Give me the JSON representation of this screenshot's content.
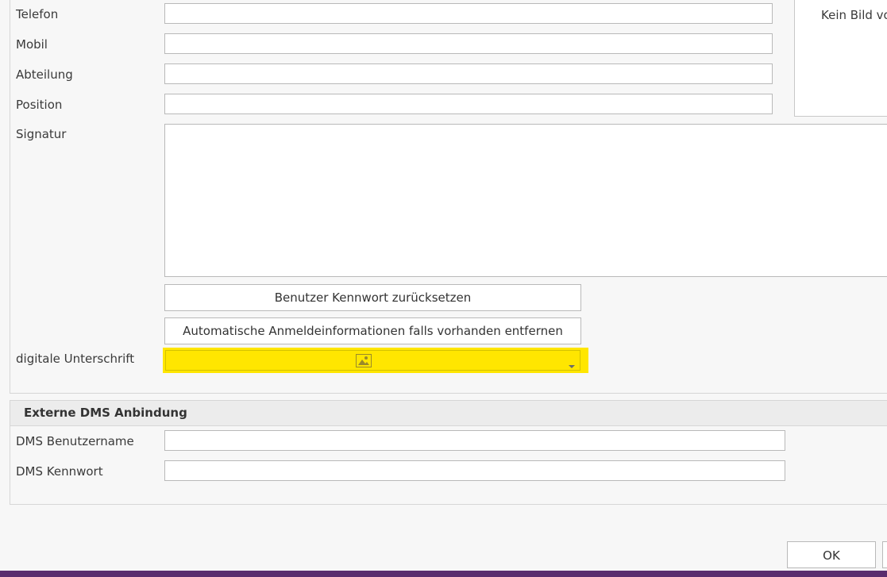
{
  "form": {
    "telefon_label": "Telefon",
    "mobil_label": "Mobil",
    "abteilung_label": "Abteilung",
    "position_label": "Position",
    "signatur_label": "Signatur",
    "digitale_unterschrift_label": "digitale Unterschrift"
  },
  "photo": {
    "placeholder_text": "Kein Bild vo"
  },
  "buttons": {
    "reset_password": "Benutzer Kennwort zurücksetzen",
    "remove_autologin": "Automatische Anmeldeinformationen falls vorhanden entfernen",
    "ok": "OK"
  },
  "dms": {
    "section_title": "Externe DMS Anbindung",
    "username_label": "DMS Benutzername",
    "password_label": "DMS Kennwort"
  },
  "colors": {
    "highlight": "#ffe600",
    "bottom_bar": "#5a2d6e"
  },
  "icons": {
    "signature_combo": "image-icon",
    "dropdown": "chevron-down-icon"
  }
}
